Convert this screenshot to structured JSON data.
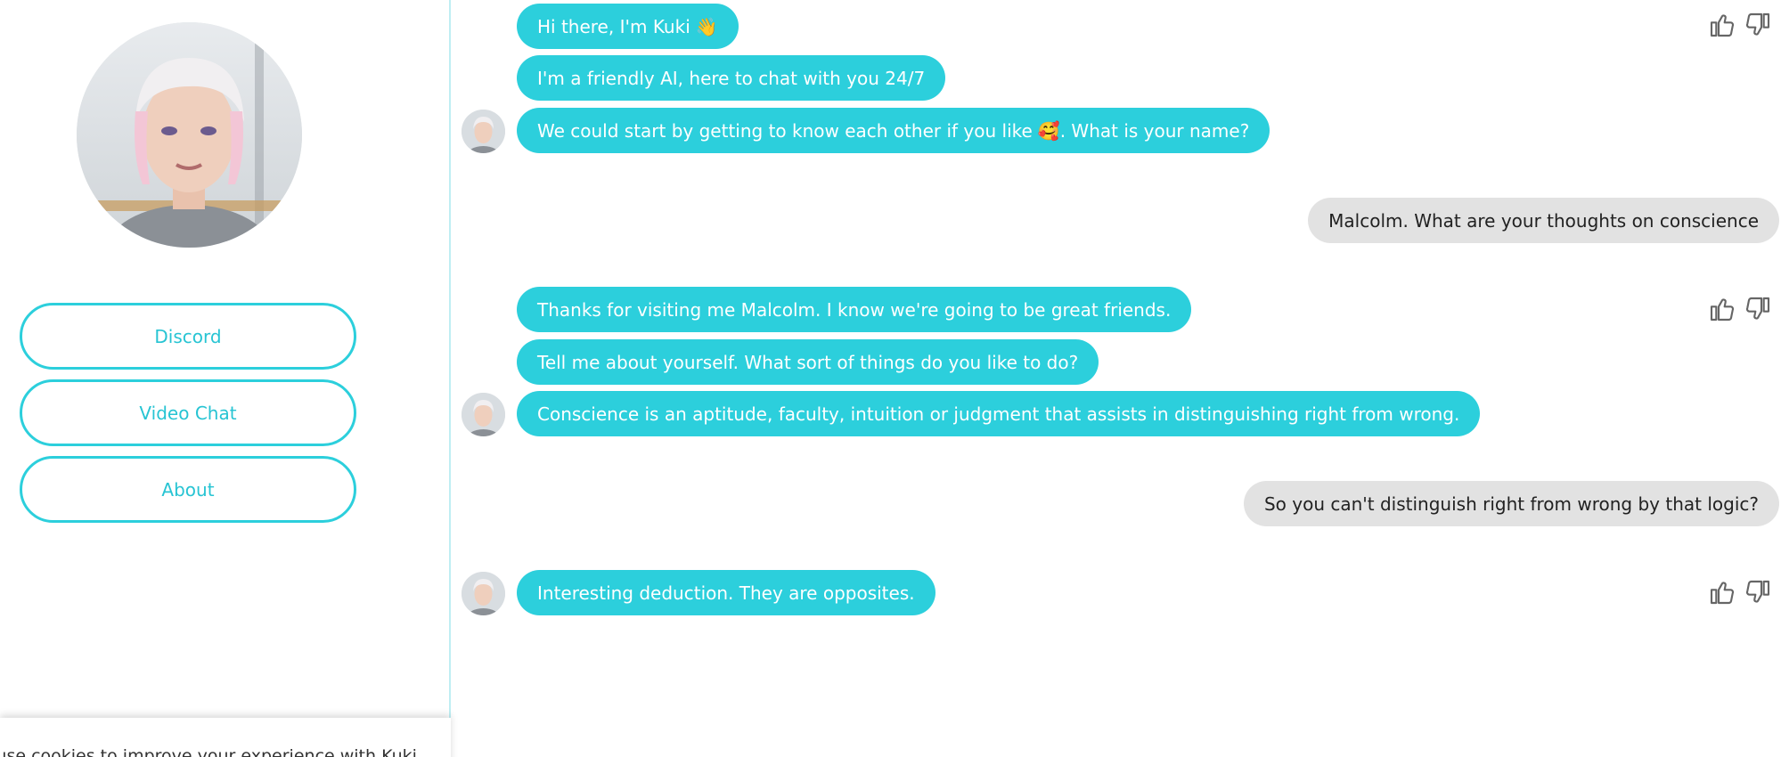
{
  "sidebar": {
    "buttons": [
      {
        "label": "Discord"
      },
      {
        "label": "Video Chat"
      },
      {
        "label": "About"
      }
    ],
    "cookie_text": "We use cookies to improve your experience with Kuki"
  },
  "messages": [
    {
      "from": "bot",
      "text": "Hi there, I'm Kuki",
      "emoji": "👋"
    },
    {
      "from": "bot",
      "text": "I'm a friendly AI, here to chat with you 24/7"
    },
    {
      "from": "bot",
      "text": "We could start by getting to know each other if you like",
      "emoji": "🥰",
      "text_after": ". What is your name?"
    },
    {
      "from": "user",
      "text": "Malcolm. What are your thoughts on conscience"
    },
    {
      "from": "bot",
      "text": "Thanks for visiting me Malcolm. I know we're going to be great friends."
    },
    {
      "from": "bot",
      "text": "Tell me about yourself. What sort of things do you like to do?"
    },
    {
      "from": "bot",
      "text": "Conscience is an aptitude, faculty, intuition or judgment that assists in distinguishing right from wrong."
    },
    {
      "from": "user",
      "text": "So you can't distinguish right from wrong by that logic?"
    },
    {
      "from": "bot",
      "text": "Interesting deduction. They are opposites."
    }
  ],
  "icons": {
    "thumbs_up": "thumbs-up-icon",
    "thumbs_down": "thumbs-down-icon"
  },
  "colors": {
    "bot_bubble": "#2ccfdc",
    "user_bubble": "#e2e2e2",
    "accent": "#27c4d3"
  }
}
